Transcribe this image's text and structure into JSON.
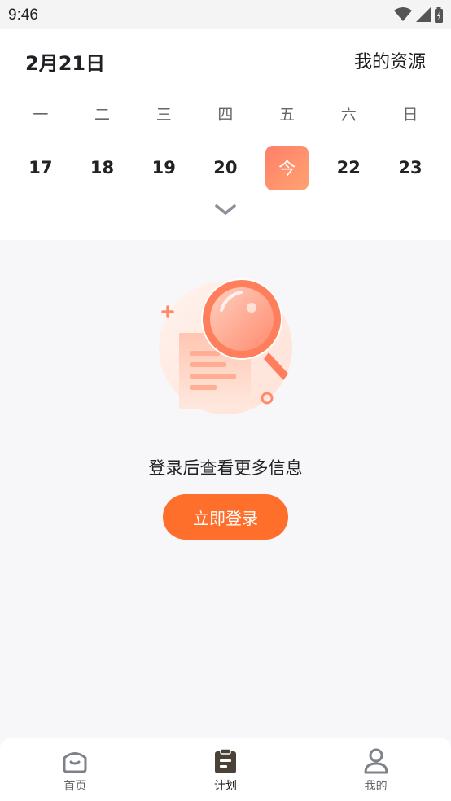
{
  "status_bar": {
    "time": "9:46",
    "icons": [
      "wifi-icon",
      "signal-icon",
      "battery-icon"
    ]
  },
  "header": {
    "date": "2月21日",
    "resources_link": "我的资源"
  },
  "calendar": {
    "weekdays": [
      "一",
      "二",
      "三",
      "四",
      "五",
      "六",
      "日"
    ],
    "days": [
      "17",
      "18",
      "19",
      "20",
      "今",
      "22",
      "23"
    ],
    "today_index": 4,
    "today_color": "#ff8a6b"
  },
  "empty_state": {
    "message": "登录后查看更多信息",
    "login_button": "立即登录",
    "button_color": "#ff6f2c"
  },
  "tab_bar": {
    "tabs": [
      {
        "label": "首页",
        "icon": "home-icon"
      },
      {
        "label": "计划",
        "icon": "clipboard-icon"
      },
      {
        "label": "我的",
        "icon": "user-icon"
      }
    ],
    "active_index": 1
  }
}
